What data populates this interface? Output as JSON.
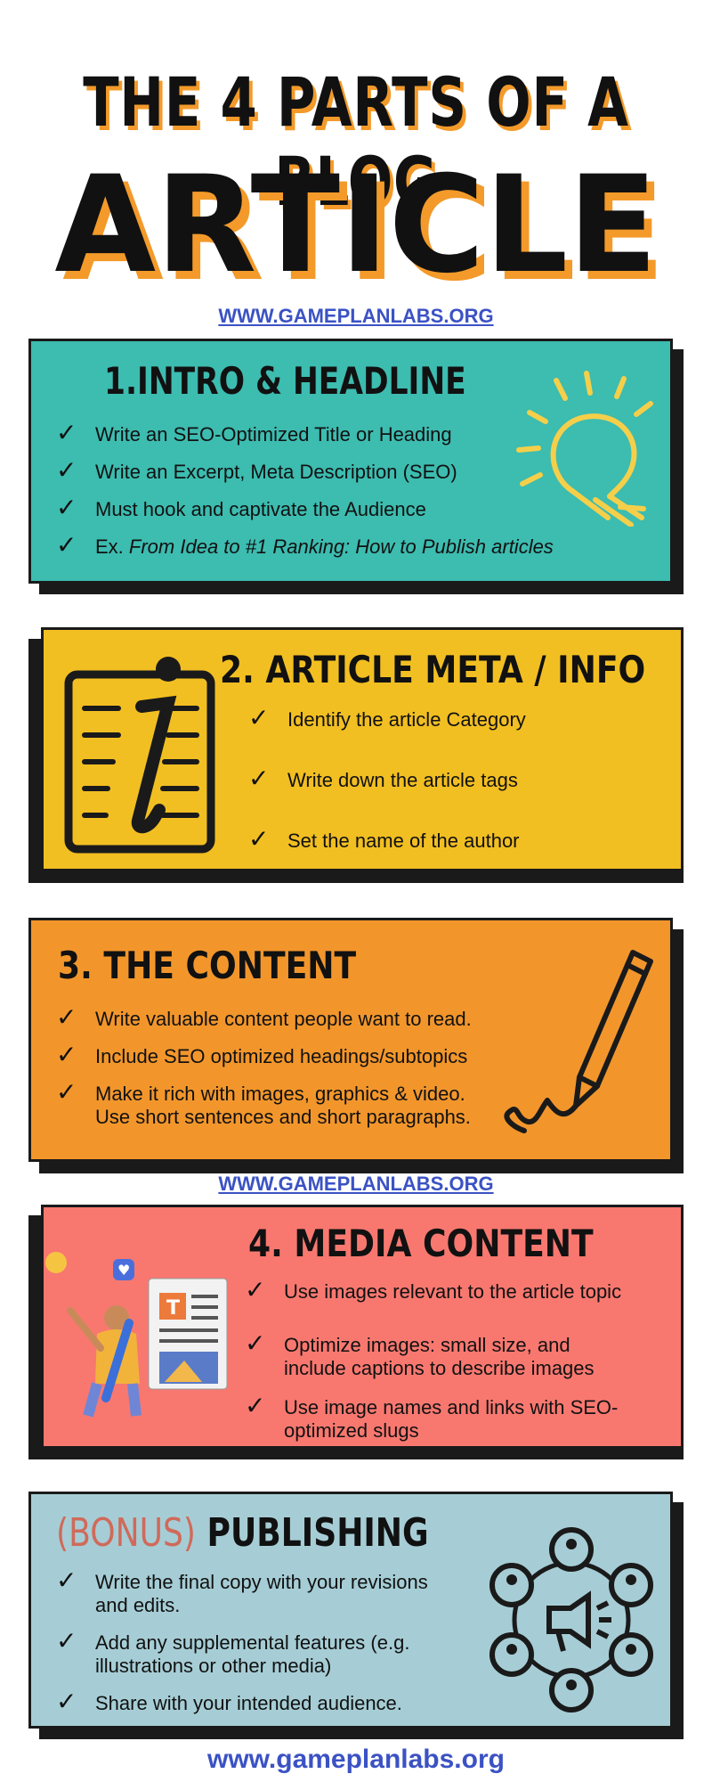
{
  "title": {
    "line1": "THE 4 PARTS OF A BLOG",
    "line2": "ARTICLE"
  },
  "links": {
    "top": "WWW.GAMEPLANLABS.ORG",
    "middle": "WWW.GAMEPLANLABS.ORG",
    "bottom": "www.gameplanlabs.org"
  },
  "sections": [
    {
      "heading": "1.INTRO & HEADLINE",
      "color": "#3dbcb0",
      "items": [
        "Write an SEO-Optimized Title or Heading",
        "Write an Excerpt, Meta Description (SEO)",
        "Must hook and captivate the Audience"
      ],
      "example_prefix": "Ex.",
      "example_text": "From Idea to #1 Ranking: How to Publish articles",
      "icon": "lightbulb-icon"
    },
    {
      "heading": "2. ARTICLE META / INFO",
      "color": "#f2bf22",
      "items": [
        "Identify the article Category",
        "Write down the article tags",
        "Set the name of the author"
      ],
      "icon": "info-document-icon"
    },
    {
      "heading": "3. THE CONTENT",
      "color": "#f2962c",
      "items": [
        "Write valuable content people want to read.",
        "Include SEO optimized headings/subtopics",
        "Make it rich with images, graphics & video.",
        "Use short sentences and short paragraphs."
      ],
      "icon": "pencil-icon"
    },
    {
      "heading": "4. MEDIA CONTENT",
      "color": "#f87870",
      "items": [
        "Use images relevant to the article topic",
        "Optimize images: small size, and",
        "include captions to describe images",
        "Use image names and links with SEO-",
        "optimized slugs"
      ],
      "icon": "creator-illustration"
    },
    {
      "heading_prefix": "(BONUS)",
      "heading": "PUBLISHING",
      "color": "#a6cdd5",
      "prefix_color": "#d06a5a",
      "items": [
        "Write the final copy with your revisions",
        "and edits.",
        "Add any supplemental features (e.g.",
        "illustrations or other media)",
        "Share with your intended audience."
      ],
      "icon": "audience-network-icon"
    }
  ],
  "check_glyph": "✓"
}
